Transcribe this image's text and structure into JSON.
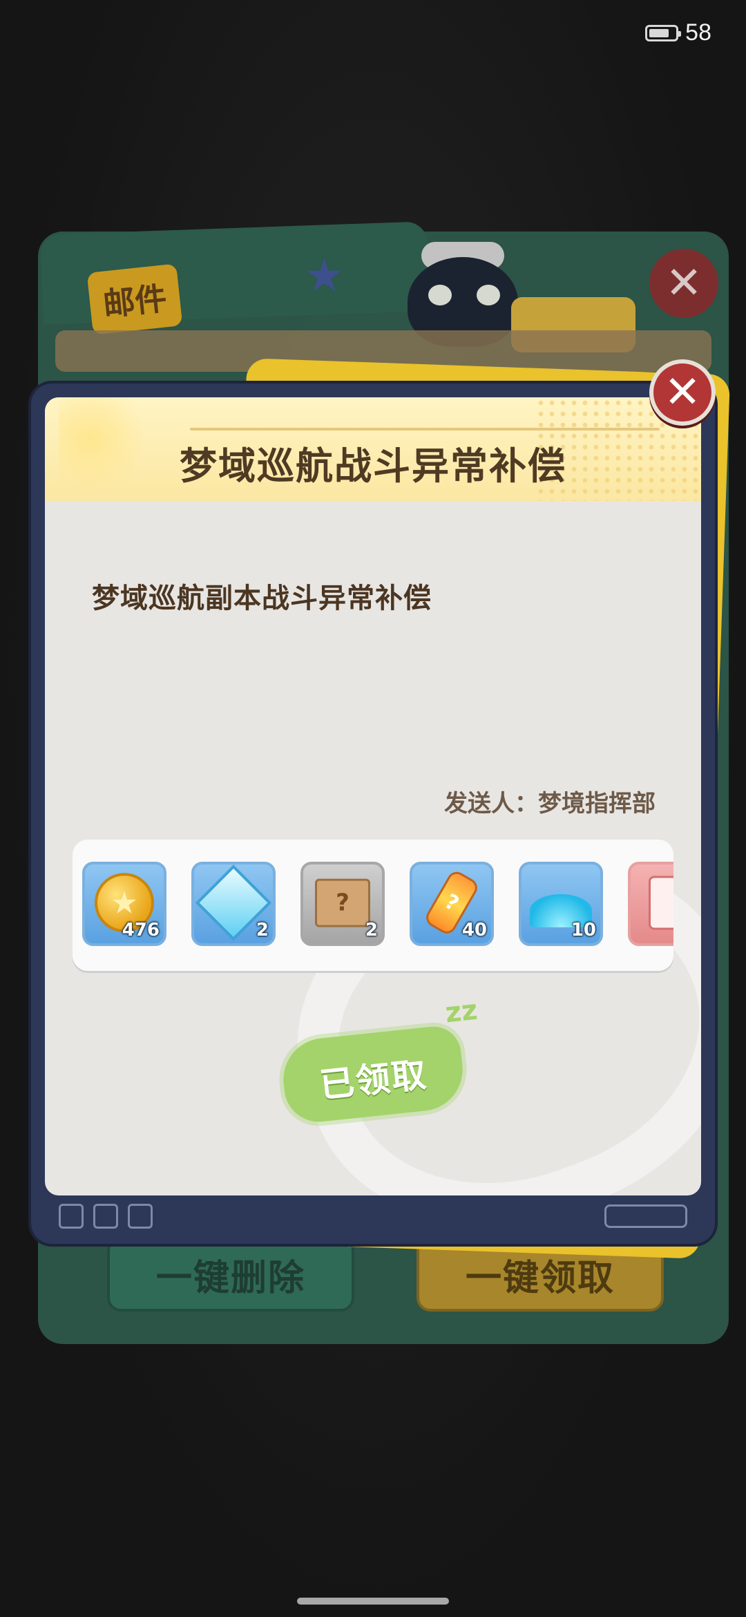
{
  "status_bar": {
    "battery_level": "58"
  },
  "background_window": {
    "tab_label": "邮件",
    "delete_all_label": "一键删除",
    "claim_all_label": "一键领取"
  },
  "popup": {
    "title": "梦域巡航战斗异常补偿",
    "body": "梦域巡航副本战斗异常补偿",
    "sender_label": "发送人：",
    "sender_name": "梦境指挥部",
    "claimed_label": "已领取",
    "rewards": [
      {
        "icon": "gold-coin-icon",
        "qty": "476"
      },
      {
        "icon": "crystal-icon",
        "qty": "2"
      },
      {
        "icon": "mystery-box-icon",
        "qty": "2"
      },
      {
        "icon": "energy-drink-icon",
        "qty": "40"
      },
      {
        "icon": "blue-powder-icon",
        "qty": "10"
      },
      {
        "icon": "pink-card-icon",
        "qty": ""
      }
    ]
  }
}
